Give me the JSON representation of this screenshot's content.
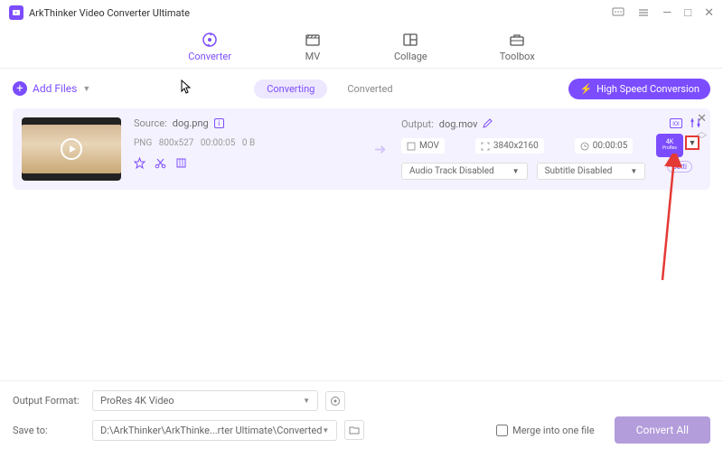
{
  "titlebar": {
    "title": "ArkThinker Video Converter Ultimate"
  },
  "nav": {
    "converter": "Converter",
    "mv": "MV",
    "collage": "Collage",
    "toolbox": "Toolbox"
  },
  "toolbar": {
    "add_files": "Add Files",
    "tab_converting": "Converting",
    "tab_converted": "Converted",
    "high_speed": "High Speed Conversion"
  },
  "item": {
    "source_label": "Source:",
    "source_name": "dog.png",
    "src_format": "PNG",
    "src_res": "800x527",
    "src_dur": "00:00:05",
    "src_size": "0 B",
    "output_label": "Output:",
    "output_name": "dog.mov",
    "out_format": "MOV",
    "out_res": "3840x2160",
    "out_dur": "00:00:05",
    "audio_track": "Audio Track Disabled",
    "subtitle": "Subtitle Disabled",
    "badge_top": "4K",
    "badge_bot": "ProRes",
    "settings": "Setti"
  },
  "footer": {
    "output_format_label": "Output Format:",
    "output_format_value": "ProRes 4K Video",
    "save_to_label": "Save to:",
    "save_to_value": "D:\\ArkThinker\\ArkThinke...rter Ultimate\\Converted",
    "merge_label": "Merge into one file",
    "convert_all": "Convert All"
  }
}
